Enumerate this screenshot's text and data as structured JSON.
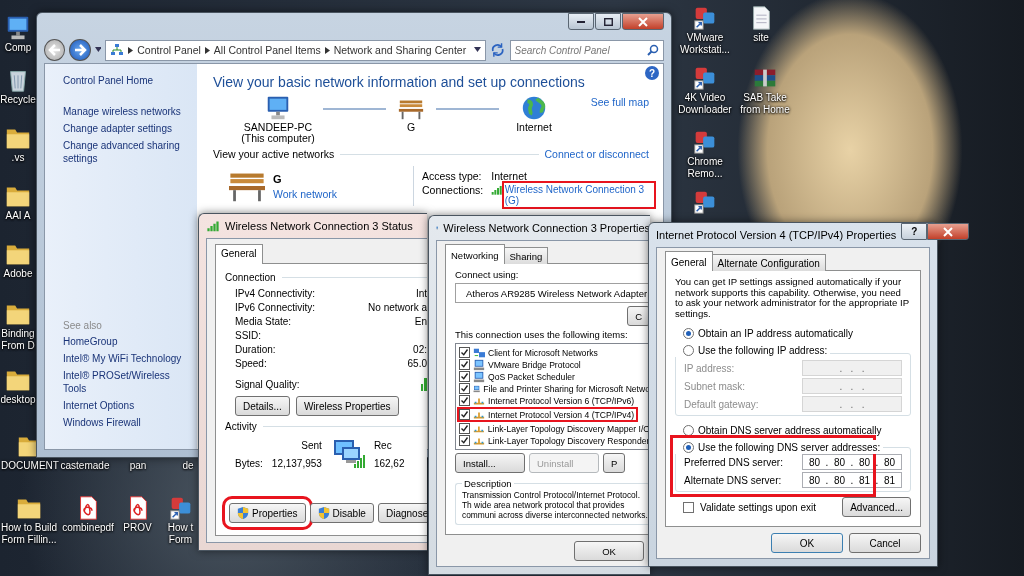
{
  "desktop_icons": [
    {
      "label": "Comp",
      "kind": "computer"
    },
    {
      "label": "Recycle",
      "kind": "recycle"
    },
    {
      "label": ".vs",
      "kind": "folder"
    },
    {
      "label": "AAI A",
      "kind": "folder"
    },
    {
      "label": "Adobe",
      "kind": "folder"
    },
    {
      "label": "Binding From D",
      "kind": "folder"
    },
    {
      "label": "desktop",
      "kind": "folder"
    },
    {
      "label": "DOCUMENT",
      "kind": "folder"
    },
    {
      "label": "castemade",
      "kind": "none"
    },
    {
      "label": "pan",
      "kind": "none"
    },
    {
      "label": "de",
      "kind": "none"
    },
    {
      "label": "How to Build Form Fillin...",
      "kind": "folder"
    },
    {
      "label": "combinepdf",
      "kind": "pdf"
    },
    {
      "label": "PROV",
      "kind": "pdf"
    },
    {
      "label": "How t Form",
      "kind": "app"
    },
    {
      "label": "VMware Workstati...",
      "kind": "app"
    },
    {
      "label": "site",
      "kind": "file"
    },
    {
      "label": "4K Video Downloader",
      "kind": "app"
    },
    {
      "label": "SAB Take from Home",
      "kind": "archive"
    },
    {
      "label": "Chrome Remo...",
      "kind": "app"
    },
    {
      "kind": "app"
    }
  ],
  "control_panel": {
    "breadcrumbs": [
      "Control Panel",
      "All Control Panel Items",
      "Network and Sharing Center"
    ],
    "search": {
      "placeholder": "Search Control Panel"
    },
    "help": "?",
    "sidebar_links": [
      "Control Panel Home",
      "Manage wireless networks",
      "Change adapter settings",
      "Change advanced sharing settings"
    ],
    "see_also_heading": "See also",
    "see_also": [
      "HomeGroup",
      "Intel® My WiFi Technology",
      "Intel® PROSet/Wireless Tools",
      "Internet Options",
      "Windows Firewall"
    ],
    "heading": "View your basic network information and set up connections",
    "map_nodes": [
      {
        "name": "SANDEEP-PC",
        "sub": "(This computer)",
        "kind": "computer"
      },
      {
        "name": "G",
        "kind": "bench"
      },
      {
        "name": "Internet",
        "kind": "globe"
      }
    ],
    "see_full_map": "See full map",
    "active_heading": "View your active networks",
    "connect_link": "Connect or disconnect",
    "network": {
      "name": "G",
      "type": "Work network"
    },
    "access_label": "Access type:",
    "access_value": "Internet",
    "connections_label": "Connections:",
    "connection": {
      "label": "Wireless Network Connection 3 (G)",
      "highlighted": true
    }
  },
  "status": {
    "title": "Wireless Network Connection 3 Status",
    "tab": "General",
    "connection_heading": "Connection",
    "rows": [
      {
        "label": "IPv4 Connectivity:",
        "value": "Int"
      },
      {
        "label": "IPv6 Connectivity:",
        "value": "No network a"
      },
      {
        "label": "Media State:",
        "value": "En"
      },
      {
        "label": "SSID:"
      },
      {
        "label": "Duration:",
        "value": "02:"
      },
      {
        "label": "Speed:",
        "value": "65.0"
      }
    ],
    "signal_label": "Signal Quality:",
    "mid_buttons": [
      "Details...",
      "Wireless Properties"
    ],
    "activity_heading": "Activity",
    "sent": "Sent",
    "received": "Rec",
    "bytes_label": "Bytes:",
    "sent_bytes": "12,137,953",
    "received_bytes": "162,62",
    "buttons": [
      {
        "label": "Properties",
        "shield": true,
        "highlighted": true
      },
      {
        "label": "Disable",
        "shield": true,
        "highlighted": false
      },
      {
        "label": "Diagnose",
        "shield": false,
        "highlighted": false
      }
    ]
  },
  "properties": {
    "title": "Wireless Network Connection 3 Properties",
    "tabs": [
      {
        "label": "Networking",
        "selected": true
      },
      {
        "label": "Sharing",
        "selected": false
      }
    ],
    "connect_using": "Connect using:",
    "adapter": "Atheros AR9285 Wireless Network Adapter",
    "configure": "C",
    "items_heading": "This connection uses the following items:",
    "items": [
      {
        "label": "Client for Microsoft Networks",
        "kind": "client",
        "checked": true,
        "highlighted": false
      },
      {
        "label": "VMware Bridge Protocol",
        "kind": "service",
        "checked": true,
        "highlighted": false
      },
      {
        "label": "QoS Packet Scheduler",
        "kind": "service",
        "checked": true,
        "highlighted": false
      },
      {
        "label": "File and Printer Sharing for Microsoft Netwo",
        "kind": "service",
        "checked": true,
        "highlighted": false
      },
      {
        "label": "Internet Protocol Version 6 (TCP/IPv6)",
        "kind": "protocol",
        "checked": true,
        "highlighted": false
      },
      {
        "label": "Internet Protocol Version 4 (TCP/IPv4)",
        "kind": "protocol",
        "checked": true,
        "highlighted": true
      },
      {
        "label": "Link-Layer Topology Discovery Mapper I/O",
        "kind": "protocol",
        "checked": true,
        "highlighted": false
      },
      {
        "label": "Link-Layer Topology Discovery Responder",
        "kind": "protocol",
        "checked": true,
        "highlighted": false
      }
    ],
    "buttons": [
      {
        "label": "Install...",
        "disabled": false
      },
      {
        "label": "Uninstall",
        "disabled": true
      },
      {
        "label": "P",
        "disabled": false
      }
    ],
    "description_heading": "Description",
    "description": "Transmission Control Protocol/Internet Protocol. Th wide area network protocol that provides communi across diverse interconnected networks.",
    "ok": "OK"
  },
  "ipv4": {
    "title": "Internet Protocol Version 4 (TCP/IPv4) Properties",
    "help": "?",
    "tabs": [
      {
        "label": "General",
        "selected": true
      },
      {
        "label": "Alternate Configuration",
        "selected": false
      }
    ],
    "intro": "You can get IP settings assigned automatically if your network supports this capability. Otherwise, you need to ask your network administrator for the appropriate IP settings.",
    "ip_modes": [
      {
        "label": "Obtain an IP address automatically",
        "selected": true
      },
      {
        "label": "Use the following IP address:",
        "selected": false
      }
    ],
    "ip_fields": [
      {
        "label": "IP address:",
        "value": ".   .   .",
        "disabled": true
      },
      {
        "label": "Subnet mask:",
        "value": ".   .   .",
        "disabled": true
      },
      {
        "label": "Default gateway:",
        "value": ".   .   .",
        "disabled": true
      }
    ],
    "dns_modes": [
      {
        "label": "Obtain DNS server address automatically",
        "selected": false
      },
      {
        "label": "Use the following DNS server addresses:",
        "selected": true
      }
    ],
    "dns_highlighted": true,
    "dns_fields": [
      {
        "label": "Preferred DNS server:",
        "value": "80  .  80  .  80  .  80",
        "disabled": false
      },
      {
        "label": "Alternate DNS server:",
        "value": "80  .  80  .  81  .  81",
        "disabled": false
      }
    ],
    "validate": {
      "label": "Validate settings upon exit",
      "checked": false
    },
    "advanced": "Advanced...",
    "buttons": [
      "OK",
      "Cancel"
    ]
  }
}
